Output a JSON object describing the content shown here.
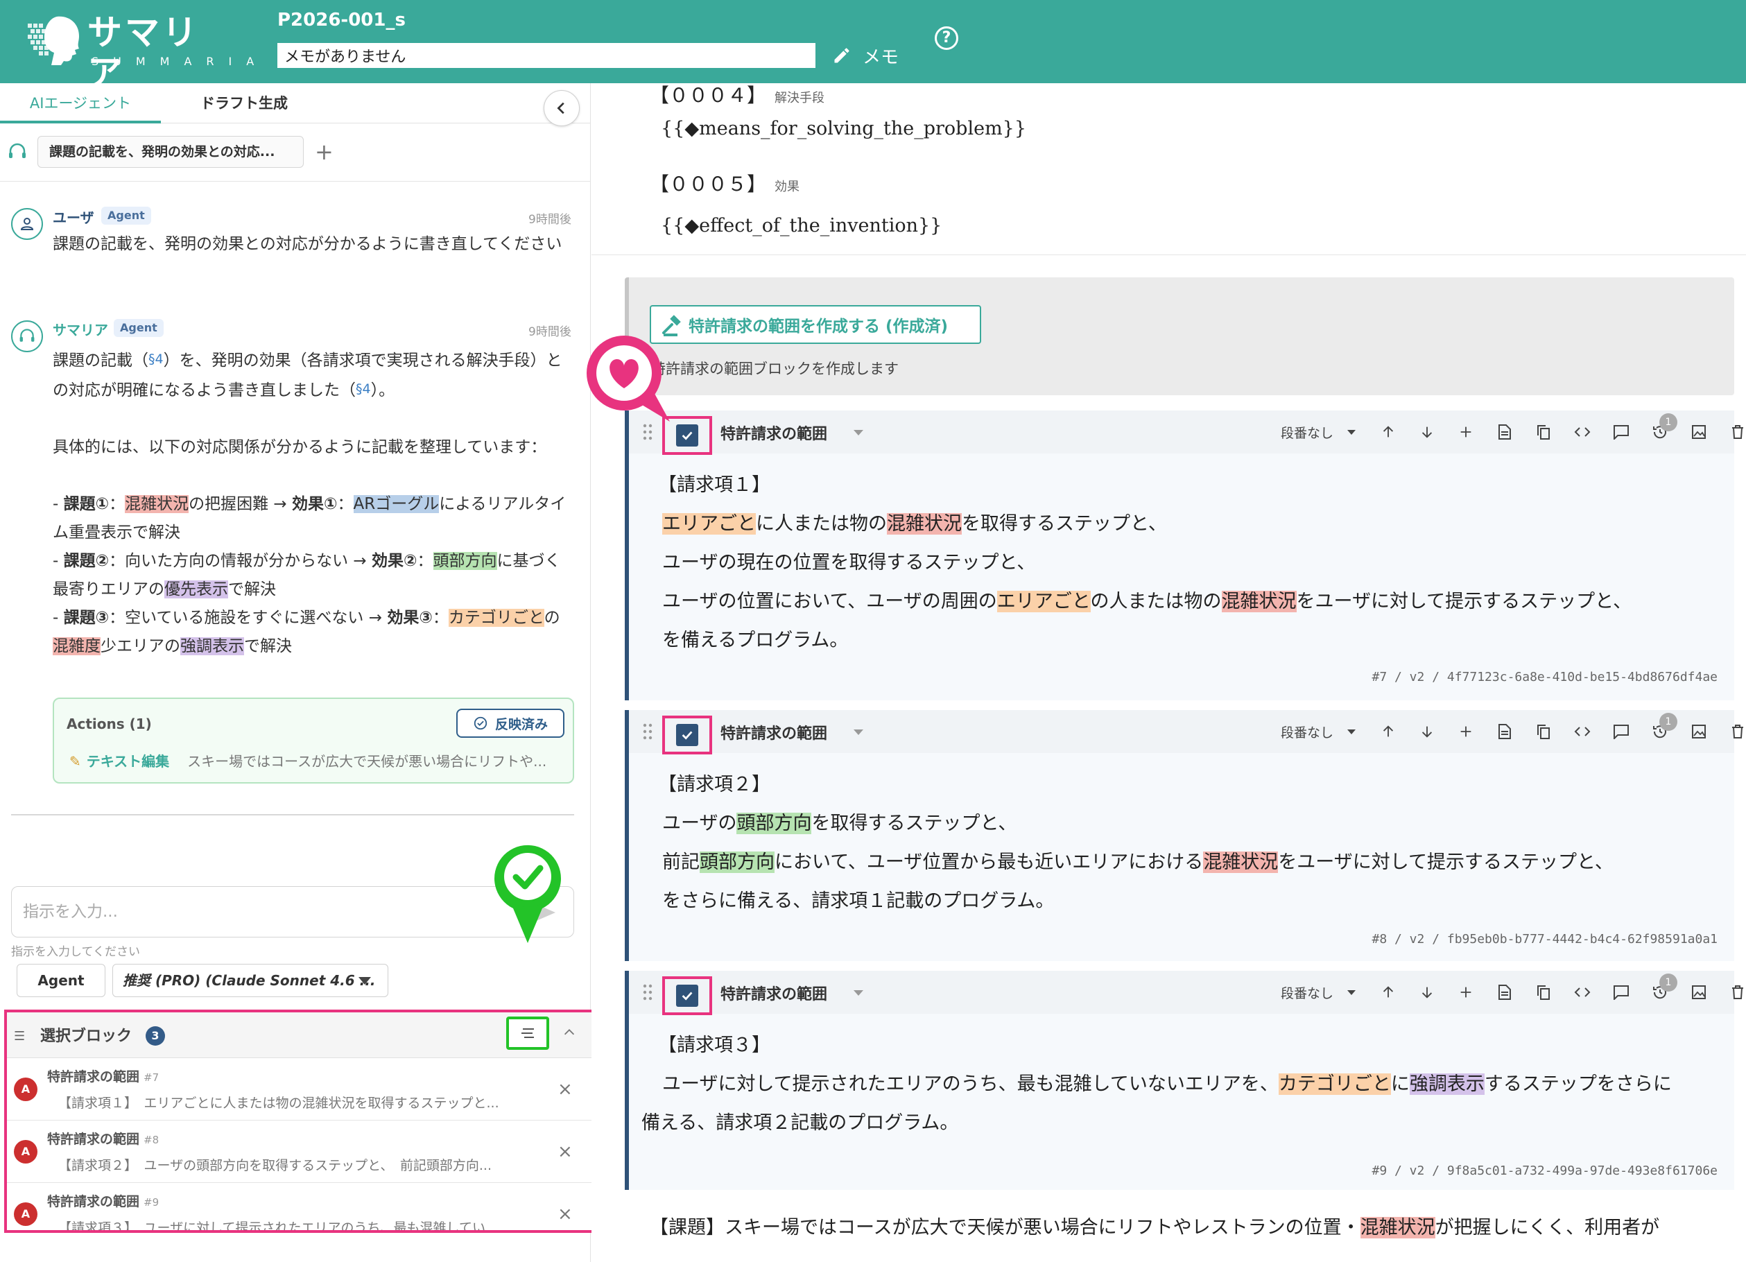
{
  "header": {
    "logo_ja": "サマリア",
    "logo_en": "SUMMARIA",
    "doc_title": "P2026-001_s",
    "memo_value": "メモがありません",
    "memo_label": "メモ",
    "help_label": "?"
  },
  "left": {
    "tabs": [
      {
        "label": "AIエージェント"
      },
      {
        "label": "ドラフト生成"
      }
    ],
    "thread_chip": "課題の記載を、発明の効果との対応...",
    "thread_add": "+",
    "messages": [
      {
        "name": "ユーザ",
        "badge": "Agent",
        "time": "9時間後",
        "text": "課題の記載を、発明の効果との対応が分かるように書き直してください"
      },
      {
        "name": "サマリア",
        "badge": "Agent",
        "time": "9時間後",
        "p1a": "課題の記載（",
        "p1ref1": "§4",
        "p1b": "）を、発明の効果（各請求項で実現される解決手段）との対応が明確になるよう書き直しました（",
        "p1ref2": "§4",
        "p1c": "）。",
        "p2": "具体的には、以下の対応関係が分かるように記載を整理しています：",
        "b1": {
          "dash": "- ",
          "k1": "課題①",
          "t1": "：",
          "h1": "混雑状況",
          "t2": "の把握困難 → ",
          "k2": "効果①",
          "t3": "：",
          "h2": "ARゴーグル",
          "t4": "によるリアルタイム重畳表示で解決"
        },
        "b2": {
          "dash": "- ",
          "k1": "課題②",
          "t1": "：向いた方向の情報が分からない → ",
          "k2": "効果②",
          "t2": "：",
          "h1": "頭部方向",
          "t3": "に基づく最寄りエリアの",
          "h2": "優先表示",
          "t4": "で解決"
        },
        "b3": {
          "dash": "- ",
          "k1": "課題③",
          "t1": "：空いている施設をすぐに選べない → ",
          "k2": "効果③",
          "t2": "：",
          "h1": "カテゴリごと",
          "t3": "の",
          "h2": "混雑度",
          "t4": "少エリアの",
          "h3": "強調表示",
          "t5": "で解決"
        }
      }
    ],
    "actions": {
      "title": "Actions (1)",
      "applied_label": "反映済み",
      "item_label": "テキスト編集",
      "item_desc": "スキー場ではコースが広大で天候が悪い場合にリフトや..."
    },
    "prompt": {
      "placeholder": "指示を入力...",
      "hint": "指示を入力してください",
      "mode": "Agent",
      "model": "推奨 (PRO) (Claude Sonnet 4.6 ..."
    },
    "selected": {
      "title": "選択ブロック",
      "count": "3",
      "items": [
        {
          "avatar": "A",
          "title": "特許請求の範囲",
          "num": "#7",
          "desc": "【請求項１】　エリアごとに人または物の混雑状況を取得するステップと..."
        },
        {
          "avatar": "A",
          "title": "特許請求の範囲",
          "num": "#8",
          "desc": "【請求項２】　ユーザの頭部方向を取得するステップと、　前記頭部方向..."
        },
        {
          "avatar": "A",
          "title": "特許請求の範囲",
          "num": "#9",
          "desc": "【請求項３】　ユーザに対して提示されたエリアのうち、最も混雑してい..."
        }
      ]
    }
  },
  "right": {
    "p4_head": "【０００４】",
    "p4_small": "解決手段",
    "p4_text": "{{◆means_for_solving_the_problem}}",
    "p5_head": "【０００５】",
    "p5_small": "効果",
    "p5_text": "{{◆effect_of_the_invention}}",
    "claim_gen": {
      "button": "特許請求の範囲を作成する (作成済)",
      "desc": "特許請求の範囲ブロックを作成します"
    },
    "block_title": "特許請求の範囲",
    "numbering": "段番なし",
    "history_count": "1",
    "claims": [
      {
        "head": "【請求項１】",
        "l1": {
          "h1": "エリアごと",
          "t1": "に人または物の",
          "h2": "混雑状況",
          "t2": "を取得するステップと、"
        },
        "l2": "ユーザの現在の位置を取得するステップと、",
        "l3": {
          "t1": "ユーザの位置において、ユーザの周囲の",
          "h1": "エリアごと",
          "t2": "の人または物の",
          "h2": "混雑状況",
          "t3": "をユーザに対して提示するステップと、"
        },
        "l4": "を備えるプログラム。",
        "meta": "#7 / v2 / 4f77123c-6a8e-410d-be15-4bd8676df4ae"
      },
      {
        "head": "【請求項２】",
        "l1": {
          "t1": "ユーザの",
          "h1": "頭部方向",
          "t2": "を取得するステップと、"
        },
        "l2": {
          "t1": "前記",
          "h1": "頭部方向",
          "t2": "において、ユーザ位置から最も近いエリアにおける",
          "h2": "混雑状況",
          "t3": "をユーザに対して提示するステップと、"
        },
        "l3": "をさらに備える、請求項１記載のプログラム。",
        "meta": "#8 / v2 / fb95eb0b-b777-4442-b4c4-62f98591a0a1"
      },
      {
        "head": "【請求項３】",
        "l1": {
          "t1": "ユーザに対して提示されたエリアのうち、最も混雑していないエリアを、",
          "h1": "カテゴリごと",
          "t2": "に",
          "h2": "強調表示",
          "t3": "するステップをさらに"
        },
        "l2": "備える、請求項２記載のプログラム。",
        "meta": "#9 / v2 / 9f8a5c01-a732-499a-97de-493e8f61706e"
      }
    ],
    "bottom": {
      "t1": "【課題】スキー場ではコースが広大で天候が悪い場合にリフトやレストランの位置・",
      "h1": "混雑状況",
      "t2": "が把握しにくく、利用者が"
    }
  }
}
